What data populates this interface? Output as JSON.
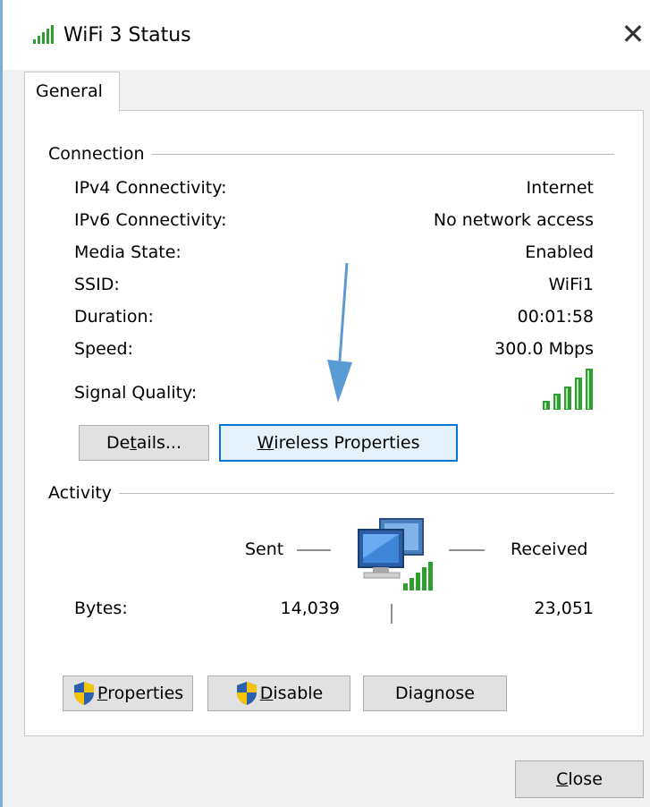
{
  "window": {
    "title": "WiFi 3 Status",
    "close_glyph": "✕"
  },
  "tabs": [
    {
      "label": "General"
    }
  ],
  "connection": {
    "title": "Connection",
    "rows": [
      {
        "label": "IPv4 Connectivity:",
        "value": "Internet"
      },
      {
        "label": "IPv6 Connectivity:",
        "value": "No network access"
      },
      {
        "label": "Media State:",
        "value": "Enabled"
      },
      {
        "label": "SSID:",
        "value": "WiFi1"
      },
      {
        "label": "Duration:",
        "value": "00:01:58"
      },
      {
        "label": "Speed:",
        "value": "300.0 Mbps"
      }
    ],
    "signal_label": "Signal Quality:",
    "signal_bars": 5,
    "details_pre": "De",
    "details_u": "t",
    "details_post": "ails...",
    "wireless_u": "W",
    "wireless_post": "ireless Properties"
  },
  "activity": {
    "title": "Activity",
    "sent_label": "Sent",
    "received_label": "Received",
    "bytes_label": "Bytes:",
    "bytes_sent": "14,039",
    "bytes_received": "23,051"
  },
  "buttons": {
    "properties_u": "P",
    "properties_post": "roperties",
    "disable_u": "D",
    "disable_post": "isable",
    "diagnose_pre": "Dia",
    "diagnose_u": "g",
    "diagnose_post": "nose",
    "close_u": "C",
    "close_post": "lose"
  },
  "colors": {
    "signal_green": "#2e9e2e",
    "focus_blue": "#0078d7",
    "annotation_arrow": "#5b9bd5"
  }
}
